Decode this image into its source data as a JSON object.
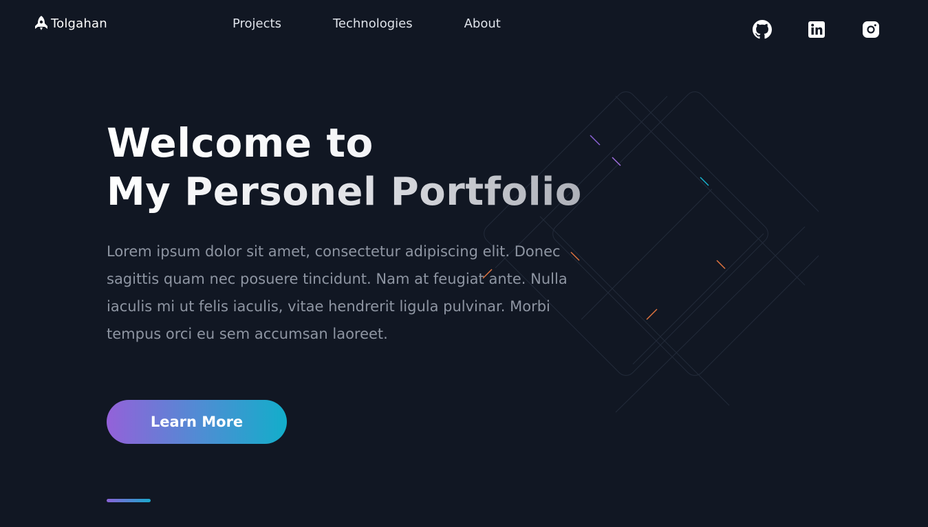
{
  "header": {
    "logo_text": "Tolgahan",
    "logo_icon": "rocket-icon",
    "nav": [
      {
        "label": "Projects"
      },
      {
        "label": "Technologies"
      },
      {
        "label": "About"
      }
    ],
    "socials": [
      {
        "name": "github-icon"
      },
      {
        "name": "linkedin-icon"
      },
      {
        "name": "instagram-icon"
      }
    ]
  },
  "hero": {
    "title_line1": "Welcome to",
    "title_line2": "My Personel Portfolio",
    "body": "Lorem ipsum dolor sit amet, consectetur adipiscing elit. Donec sagittis quam nec posuere tincidunt. Nam at feugiat ante. Nulla iaculis mi ut felis iaculis, vitae hendrerit ligula pulvinar. Morbi tempus orci eu sem accumsan laoreet.",
    "button_label": "Learn More"
  },
  "colors": {
    "background": "#111723",
    "gradient_start": "#9461d9",
    "gradient_end": "#12aeca",
    "body_text": "#8e95a2"
  }
}
